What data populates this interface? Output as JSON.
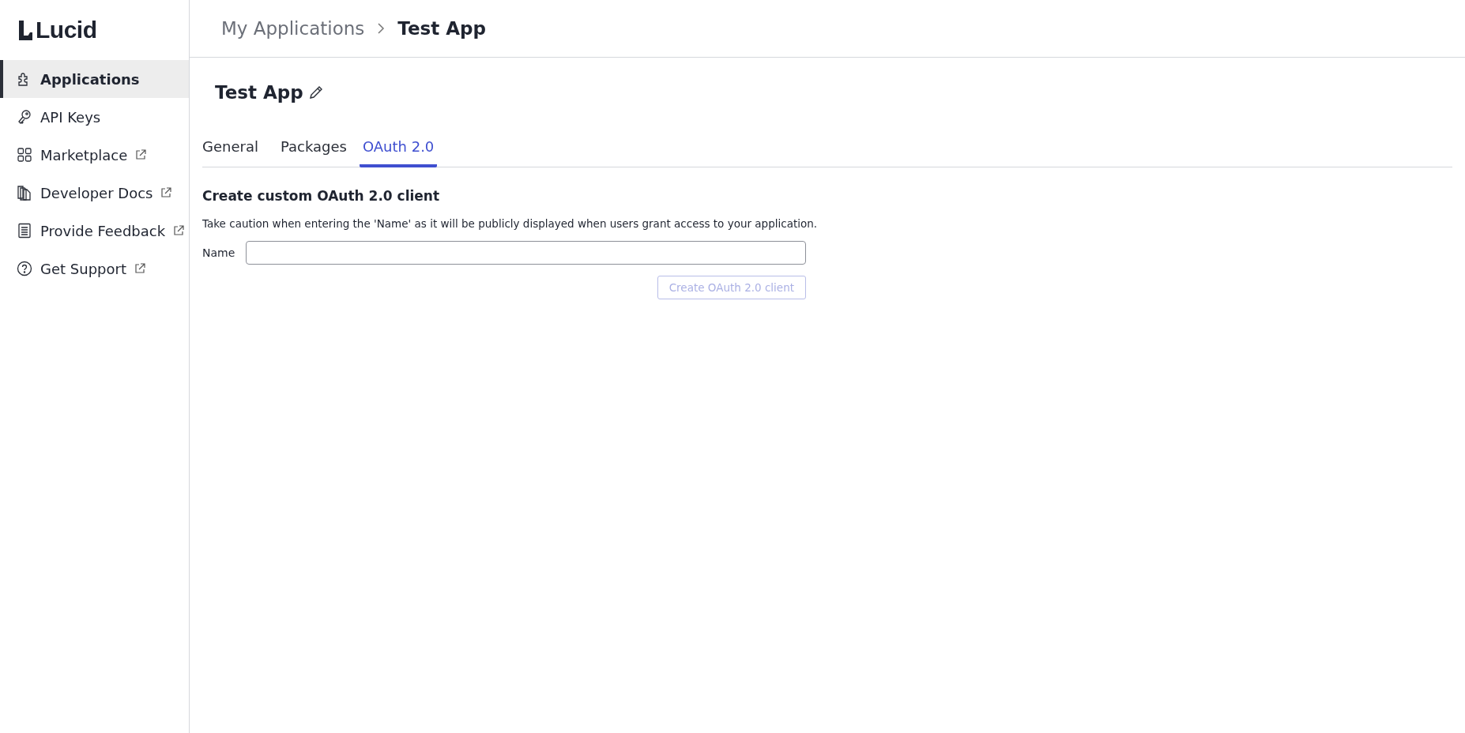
{
  "logo": {
    "text": "Lucid"
  },
  "sidebar": {
    "items": [
      {
        "label": "Applications",
        "kind": "puzzle",
        "external": false,
        "selected": true
      },
      {
        "label": "API Keys",
        "kind": "keys",
        "external": false,
        "selected": false
      },
      {
        "label": "Marketplace",
        "kind": "grid",
        "external": true,
        "selected": false
      },
      {
        "label": "Developer Docs",
        "kind": "docs",
        "external": true,
        "selected": false
      },
      {
        "label": "Provide Feedback",
        "kind": "page",
        "external": true,
        "selected": false
      },
      {
        "label": "Get Support",
        "kind": "help",
        "external": true,
        "selected": false
      }
    ]
  },
  "breadcrumb": [
    {
      "label": "My Applications",
      "current": false
    },
    {
      "label": "Test App",
      "current": true
    }
  ],
  "page_title": "Test App",
  "tabs": [
    {
      "label": "General",
      "selected": false
    },
    {
      "label": "Packages",
      "selected": false
    },
    {
      "label": "OAuth 2.0",
      "selected": true
    }
  ],
  "form": {
    "heading": "Create custom OAuth 2.0 client",
    "note": "Take caution when entering the 'Name' as it will be publicly displayed when users grant access to your application.",
    "name_label": "Name",
    "submit": {
      "label": "Create OAuth 2.0 client",
      "disabled": true
    }
  }
}
